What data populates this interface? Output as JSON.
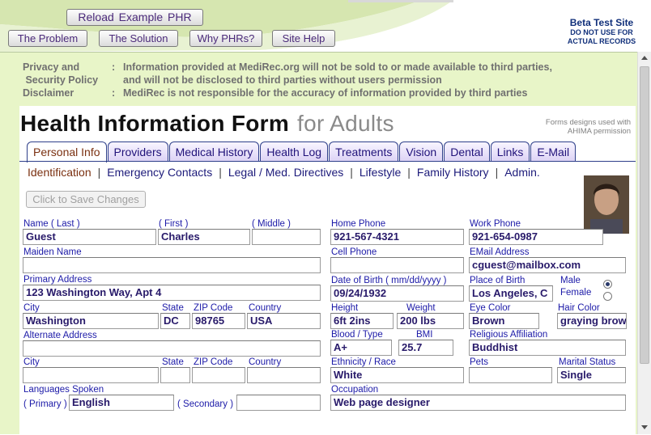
{
  "header": {
    "reload_label": "Reload  Example  PHR",
    "nav": [
      "The Problem",
      "The Solution",
      "Why PHRs?",
      "Site Help"
    ],
    "beta_title": "Beta Test Site",
    "beta_line1": "DO NOT USE FOR",
    "beta_line2": "ACTUAL RECORDS"
  },
  "privacy": {
    "label1": "Privacy and",
    "label2": " Security Policy",
    "label3": "Disclaimer",
    "sep": ":",
    "text1": "Information provided at MediRec.org will not be sold to or made available to third parties,",
    "text2": "and will not be disclosed to third parties without users permission",
    "text3": "MediRec is not responsible for the accuracy of information provided by third parties"
  },
  "form": {
    "title": "Health Information Form",
    "subtitle": "for Adults",
    "credit1": "Forms designs used with",
    "credit2": "AHIMA permission",
    "tabs": [
      "Personal Info",
      "Providers",
      "Medical History",
      "Health Log",
      "Treatments",
      "Vision",
      "Dental",
      "Links",
      "E-Mail"
    ],
    "subnav": [
      "Identification",
      "Emergency Contacts",
      "Legal / Med. Directives",
      "Lifestyle",
      "Family History",
      "Admin."
    ],
    "save_label": "Click to Save Changes"
  },
  "fields": {
    "name_last_label": "Name ( Last )",
    "name_first_label": "( First )",
    "name_middle_label": "( Middle )",
    "last": "Guest",
    "first": "Charles",
    "middle": "",
    "maiden_label": "Maiden Name",
    "maiden": "",
    "primary_address_label": "Primary Address",
    "primary_address": "123 Washington Way, Apt 4",
    "city_label": "City",
    "state_label": "State",
    "zip_label": "ZIP Code",
    "country_label": "Country",
    "city": "Washington",
    "state": "DC",
    "zip": "98765",
    "country": "USA",
    "alt_address_label": "Alternate Address",
    "alt_address": "",
    "city2_label": "City",
    "state2_label": "State",
    "zip2_label": "ZIP Code",
    "country2_label": "Country",
    "languages_label": "Languages Spoken",
    "primary_lang_label": "( Primary )",
    "primary_lang": "English",
    "secondary_lang_label": "( Secondary )",
    "secondary_lang": "",
    "home_phone_label": "Home Phone",
    "home_phone": "921-567-4321",
    "work_phone_label": "Work Phone",
    "work_phone": "921-654-0987",
    "cell_label": "Cell Phone",
    "cell": "",
    "email_label": "EMail Address",
    "email": "cguest@mailbox.com",
    "dob_label": "Date of Birth  ( mm/dd/yyyy )",
    "dob": "09/24/1932",
    "pob_label": "Place of Birth",
    "pob": "Los Angeles, C",
    "male_label": "Male",
    "female_label": "Female",
    "height_label": "Height",
    "height": "6ft 2ins",
    "weight_label": "Weight",
    "weight": "200 lbs",
    "eye_label": "Eye Color",
    "eye": "Brown",
    "hair_label": "Hair Color",
    "hair": "graying brow",
    "blood_label": "Blood / Type",
    "blood": "A+",
    "bmi_label": "BMI",
    "bmi": "25.7",
    "religion_label": "Religious Affiliation",
    "religion": "Buddhist",
    "ethnicity_label": "Ethnicity / Race",
    "ethnicity": "White",
    "pets_label": "Pets",
    "pets": "",
    "marital_label": "Marital Status",
    "marital": "Single",
    "occupation_label": "Occupation",
    "occupation": "Web page designer"
  },
  "colors": {
    "content_bg": "#e8f5c8",
    "label_blue": "#1c1aa8",
    "tab_border": "#2e3f8a"
  }
}
